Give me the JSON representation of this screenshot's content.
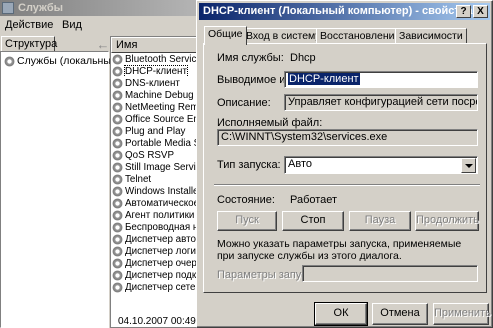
{
  "bg": {
    "title": "Службы",
    "menu": [
      "Действие",
      "Вид"
    ],
    "tree_tab": "Структура",
    "tree_root": "Службы (локальные)",
    "list_header": "Имя",
    "services": [
      "Bluetooth Service",
      "DHCP-клиент",
      "DNS-клиент",
      "Machine Debug Man",
      "NetMeeting Remote",
      "Office Source Engin",
      "Plug and Play",
      "Portable Media Seri.",
      "QoS RSVP",
      "Still Image Service",
      "Telnet",
      "Windows Installer",
      "Автоматическое о..",
      "Агент политики IP",
      "Беспроводная нас..",
      "Диспетчер авто-п..",
      "Диспетчер логиче..",
      "Диспетчер очеред..",
      "Диспетчер подкл..",
      "Диспетчер сетево.."
    ],
    "selected_index": 1,
    "status": "04.10.2007 00:49"
  },
  "dialog": {
    "title": "DHCP-клиент (Локальный компьютер) - свойства",
    "help_btn": "?",
    "close_btn": "X",
    "tabs": [
      "Общие",
      "Вход в систему",
      "Восстановление",
      "Зависимости"
    ],
    "active_tab": 0,
    "service_name_label": "Имя службы:",
    "service_name_value": "Dhcp",
    "display_name_label": "Выводимое имя:",
    "display_name_value": "DHCP-клиент",
    "description_label": "Описание:",
    "description_value": "Управляет конфигурацией сети посредством регис",
    "exe_label": "Исполняемый файл:",
    "exe_value": "C:\\WINNT\\System32\\services.exe",
    "startup_label": "Тип запуска:",
    "startup_value": "Авто",
    "state_label": "Состояние:",
    "state_value": "Работает",
    "btn_start": "Пуск",
    "btn_stop": "Стоп",
    "btn_pause": "Пауза",
    "btn_continue": "Продолжить",
    "params_note": "Можно указать параметры запуска, применяемые при запуске службы из этого диалога.",
    "params_label": "Параметры запуска:",
    "btn_ok": "ОК",
    "btn_cancel": "Отмена",
    "btn_apply": "Применить"
  }
}
